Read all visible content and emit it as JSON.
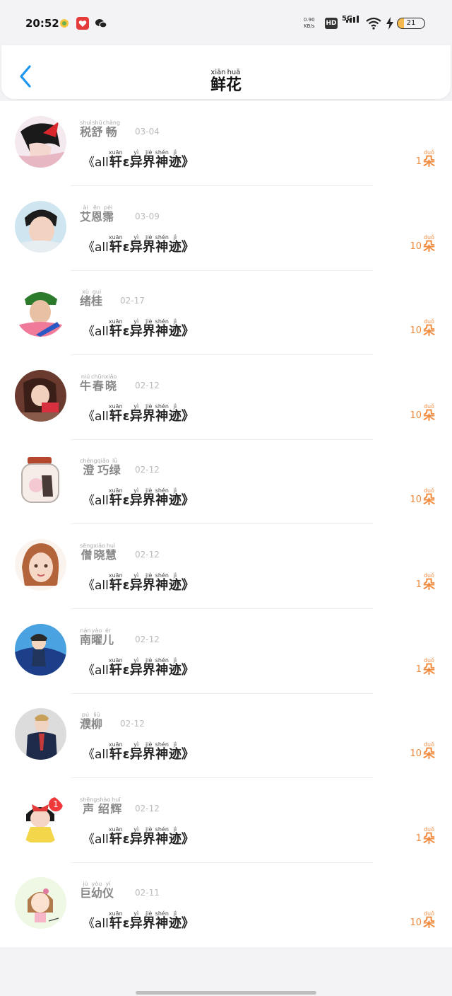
{
  "status_bar": {
    "time": "20:52",
    "net_speed_value": "0.90",
    "net_speed_unit": "KB/s",
    "hd": "HD",
    "network": "5G",
    "battery": "21",
    "icons": [
      "app-notification-icon",
      "app-red-icon",
      "wechat-icon",
      "signal-icon",
      "wifi-icon",
      "charging-icon",
      "battery-icon"
    ]
  },
  "header": {
    "back_icon": "chevron-left-icon",
    "title": [
      {
        "py": "xiān",
        "hz": "鲜"
      },
      {
        "py": "huā",
        "hz": "花"
      }
    ],
    "colors": {
      "accent": "#1e96f0"
    }
  },
  "gift": {
    "prefix": "《all",
    "chars": [
      {
        "py": "xuān",
        "hz": "轩"
      },
      {
        "py": "",
        "hz": "ε"
      },
      {
        "py": "yì",
        "hz": "异"
      },
      {
        "py": "jiè",
        "hz": "界"
      },
      {
        "py": "shén",
        "hz": "神"
      },
      {
        "py": "jì",
        "hz": "迹"
      },
      {
        "py": "",
        "hz": "》"
      }
    ]
  },
  "unit": {
    "py": "duǒ",
    "hz": "朵"
  },
  "colors": {
    "quantity": "#f08a3e",
    "date": "#bbbbbb",
    "name": "#888888"
  },
  "entries": [
    {
      "name": [
        {
          "py": "shuì",
          "hz": "税"
        },
        {
          "py": "shū",
          "hz": "舒"
        },
        {
          "py": "chàng",
          "hz": "畅"
        }
      ],
      "date": "03-04",
      "qty": "1"
    },
    {
      "name": [
        {
          "py": "ài",
          "hz": "艾"
        },
        {
          "py": "ēn",
          "hz": "恩"
        },
        {
          "py": "pèi",
          "hz": "霈"
        }
      ],
      "date": "03-09",
      "qty": "10"
    },
    {
      "name": [
        {
          "py": "xù",
          "hz": "绪"
        },
        {
          "py": "guì",
          "hz": "桂"
        }
      ],
      "date": "02-17",
      "qty": "10"
    },
    {
      "name": [
        {
          "py": "niú",
          "hz": "牛"
        },
        {
          "py": "chūn",
          "hz": "春"
        },
        {
          "py": "xiǎo",
          "hz": "晓"
        }
      ],
      "date": "02-12",
      "qty": "10"
    },
    {
      "name": [
        {
          "py": "chéng",
          "hz": "澄"
        },
        {
          "py": "qiǎo",
          "hz": "巧"
        },
        {
          "py": "lǜ",
          "hz": "绿"
        }
      ],
      "date": "02-12",
      "qty": "10"
    },
    {
      "name": [
        {
          "py": "sēng",
          "hz": "僧"
        },
        {
          "py": "xiǎo",
          "hz": "晓"
        },
        {
          "py": "huì",
          "hz": "慧"
        }
      ],
      "date": "02-12",
      "qty": "1"
    },
    {
      "name": [
        {
          "py": "nán",
          "hz": "南"
        },
        {
          "py": "yào",
          "hz": "曜"
        },
        {
          "py": "ér",
          "hz": "儿"
        }
      ],
      "date": "02-12",
      "qty": "1"
    },
    {
      "name": [
        {
          "py": "pú",
          "hz": "濮"
        },
        {
          "py": "liǔ",
          "hz": "柳"
        }
      ],
      "date": "02-12",
      "qty": "10"
    },
    {
      "name": [
        {
          "py": "shēng",
          "hz": "声"
        },
        {
          "py": "shào",
          "hz": "绍"
        },
        {
          "py": "huī",
          "hz": "辉"
        }
      ],
      "date": "02-12",
      "qty": "1"
    },
    {
      "name": [
        {
          "py": "jù",
          "hz": "巨"
        },
        {
          "py": "yòu",
          "hz": "幼"
        },
        {
          "py": "yí",
          "hz": "仪"
        }
      ],
      "date": "02-11",
      "qty": "10"
    }
  ]
}
